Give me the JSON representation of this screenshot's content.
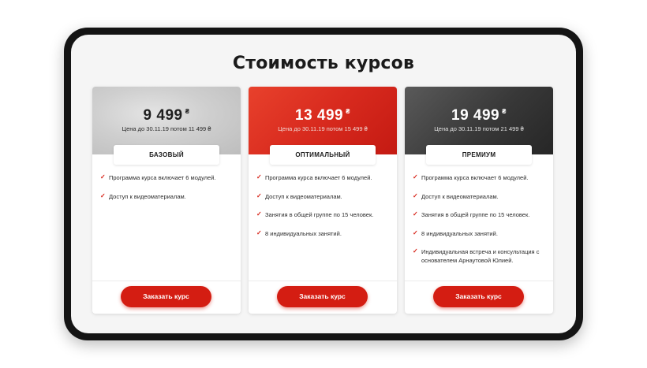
{
  "page_title": "Стоимость курсов",
  "currency": "₴",
  "plans": [
    {
      "price": "9 499",
      "note": "Цена до 30.11.19 потом 11 499 ₴",
      "name": "БАЗОВЫЙ",
      "features": [
        "Программа курса включает 6 модулей.",
        "Доступ к видеоматериалам."
      ],
      "button": "Заказать курс"
    },
    {
      "price": "13 499",
      "note": "Цена до 30.11.19 потом 15 499 ₴",
      "name": "ОПТИМАЛЬНЫЙ",
      "features": [
        "Программа курса включает 6 модулей.",
        "Доступ к видеоматериалам.",
        "Занятия в общей группе по 15 человек.",
        "8 индивидуальных занятий."
      ],
      "button": "Заказать курс"
    },
    {
      "price": "19 499",
      "note": "Цена до 30.11.19 потом 21 499 ₴",
      "name": "ПРЕМИУМ",
      "features": [
        "Программа курса включает 6 модулей.",
        "Доступ к видеоматериалам.",
        "Занятия в общей группе по 15 человек.",
        "8 индивидуальных занятий.",
        "Индивидуальная встреча и консультация с основателем Арнаутовой Юлией."
      ],
      "button": "Заказать курс"
    }
  ],
  "colors": {
    "accent": "#d41d12",
    "check": "#d62015",
    "frame": "#141414"
  },
  "icons": {
    "check": "checkmark-icon"
  }
}
